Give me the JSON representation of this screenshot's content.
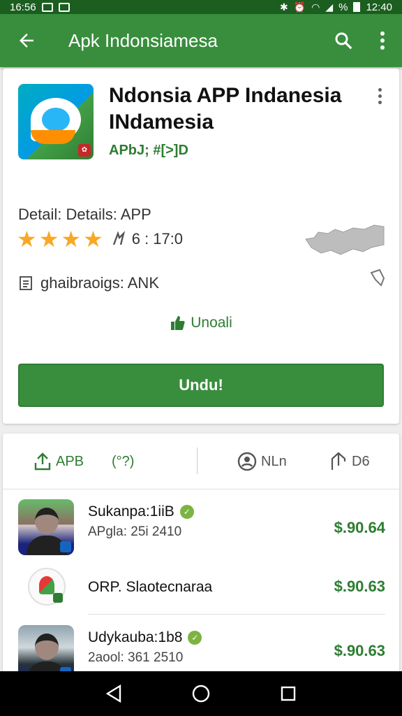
{
  "status_bar": {
    "time_left": "16:56",
    "time_right": "12:40",
    "battery_percent": "%"
  },
  "app_bar": {
    "title": "Apk Indonsiamesa"
  },
  "app": {
    "title": "Ndonsia APP Indanesia INdamesia",
    "subtitle": "APbJ; #[>]D",
    "detail": "Detail: Details: APP",
    "rating_stars": 4,
    "rating_text": "6 :",
    "rating_count": "17:0",
    "genre": "ghaibraoigs: ANK",
    "install_link": "Unoali",
    "install_button": "Undu!"
  },
  "tabs": [
    {
      "label": "APB"
    },
    {
      "label": "(°?)"
    },
    {
      "label": "NLn"
    },
    {
      "label": "D6"
    }
  ],
  "list": [
    {
      "name": "Sukanpa:1iiB",
      "sub": "APgla: 25i 2410",
      "price": "$.90.64"
    },
    {
      "name": "ORP. Slaotecnaraa",
      "sub": "",
      "price": "$.90.63"
    },
    {
      "name": "Udykauba:1b8",
      "sub": "2aool: 361 2510",
      "price": "$.90.63"
    }
  ]
}
